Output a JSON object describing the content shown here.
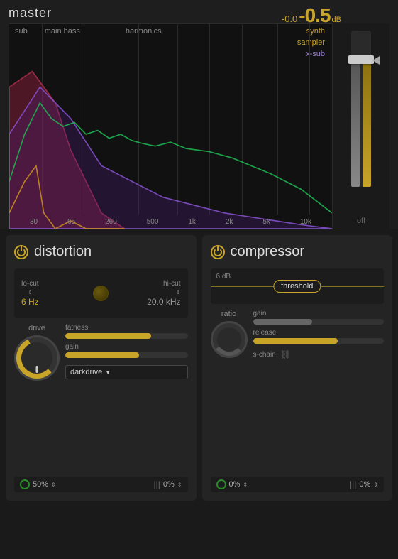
{
  "master": {
    "title": "master",
    "level_small": "-0.0",
    "level_large": "-0.5",
    "level_db": "dB",
    "fader_off": "off"
  },
  "spectrum": {
    "labels_top": [
      "sub",
      "main bass",
      "harmonics"
    ],
    "label_synth": "synth",
    "label_sampler": "sampler",
    "label_xsub": "x-sub",
    "freq_labels": [
      "30",
      "65",
      "260",
      "500",
      "1k",
      "2k",
      "5k",
      "10k"
    ]
  },
  "distortion": {
    "title": "distortion",
    "locut_label": "lo-cut",
    "locut_value": "6 Hz",
    "hicut_label": "hi-cut",
    "hicut_value": "20.0 kHz",
    "drive_label": "drive",
    "fatness_label": "fatness",
    "gain_label": "gain",
    "dropdown_value": "darkdrive",
    "bottom_left_icon": "○",
    "bottom_percent": "50%",
    "bottom_bar_icon": "|||",
    "bottom_bar_percent": "0%",
    "fatness_fill": "70",
    "gain_fill": "60"
  },
  "compressor": {
    "title": "compressor",
    "threshold_label": "threshold",
    "threshold_db": "6 dB",
    "ratio_label": "ratio",
    "gain_label": "gain",
    "release_label": "release",
    "schain_label": "s-chain",
    "bottom_left_icon": "○",
    "bottom_percent": "0%",
    "bottom_bar_icon": "|||",
    "bottom_bar_percent": "0%",
    "gain_fill": "45",
    "release_fill": "65"
  },
  "colors": {
    "accent": "#c8a428",
    "purple": "#9a7fd4",
    "green": "#2aaa2a"
  }
}
